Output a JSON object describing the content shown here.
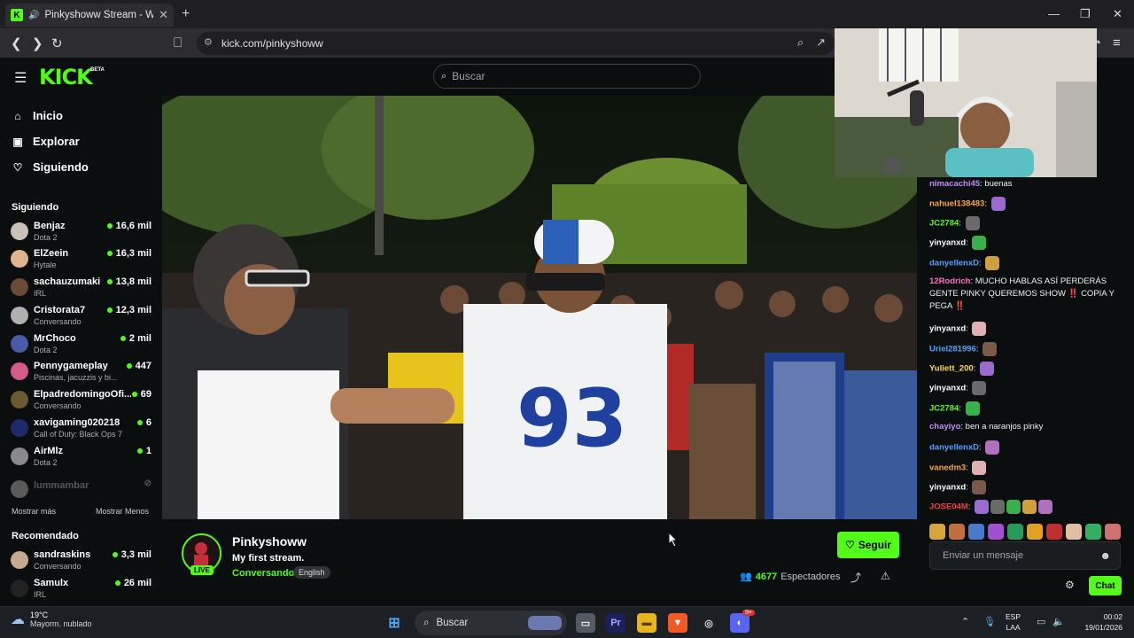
{
  "browser": {
    "tab_title": "Pinkyshoww Stream - Watch Live",
    "url": "kick.com/pinkyshoww"
  },
  "kick": {
    "logo": "KICK",
    "logo_badge": "BETA",
    "search_placeholder": "Buscar"
  },
  "sidebar": {
    "nav": [
      {
        "label": "Inicio",
        "icon": "home-icon"
      },
      {
        "label": "Explorar",
        "icon": "browse-icon"
      },
      {
        "label": "Siguiendo",
        "icon": "heart-icon"
      }
    ],
    "following_title": "Siguiendo",
    "following": [
      {
        "name": "Benjaz",
        "category": "Dota 2",
        "viewers": "16,6 mil",
        "avatar_color": "#c9c2b8"
      },
      {
        "name": "ElZeein",
        "category": "Hytale",
        "viewers": "16,3 mil",
        "avatar_color": "#e0b48c"
      },
      {
        "name": "sachauzumaki",
        "category": "IRL",
        "viewers": "13,8 mil",
        "avatar_color": "#6b4a3a"
      },
      {
        "name": "Cristorata7",
        "category": "Conversando",
        "viewers": "12,3 mil",
        "avatar_color": "#b0b0b0"
      },
      {
        "name": "MrChoco",
        "category": "Dota 2",
        "viewers": "2 mil",
        "avatar_color": "#4a5aa8"
      },
      {
        "name": "Pennygameplay",
        "category": "Piscinas, jacuzzis y bi...",
        "viewers": "447",
        "avatar_color": "#d45a8a"
      },
      {
        "name": "ElpadredomingoOfi...",
        "category": "Conversando",
        "viewers": "69",
        "avatar_color": "#6a5a30"
      },
      {
        "name": "xavigaming020218",
        "category": "Call of Duty: Black Ops 7",
        "viewers": "6",
        "avatar_color": "#1e2a6a"
      },
      {
        "name": "AirMlz",
        "category": "Dota 2",
        "viewers": "1",
        "avatar_color": "#8a8a8a"
      },
      {
        "name": "lummambar",
        "category": "",
        "viewers": "",
        "avatar_color": "#5a5a5a"
      }
    ],
    "show_more": "Mostrar más",
    "show_less": "Mostrar Menos",
    "recommended_title": "Recomendado",
    "recommended": [
      {
        "name": "sandraskins",
        "category": "Conversando",
        "viewers": "3,3 mil",
        "avatar_color": "#c8a890"
      },
      {
        "name": "Samulx",
        "category": "IRL",
        "viewers": "26 mil",
        "avatar_color": "#222222"
      }
    ]
  },
  "stream": {
    "streamer": "Pinkyshoww",
    "title": "My first stream.",
    "category": "Conversando",
    "language": "English",
    "live_badge": "LIVE",
    "follow_label": "Seguir",
    "viewer_count": "4677",
    "viewer_label": "Espectadores"
  },
  "chat": {
    "messages": [
      {
        "user": "nimacachi45",
        "color": "#c58af9",
        "text": "buenas",
        "emotes": 0
      },
      {
        "user": "nahuel138483",
        "color": "#f7a641",
        "text": "",
        "emotes": 1
      },
      {
        "user": "JC2784",
        "color": "#53fc18",
        "text": "",
        "emotes": 1
      },
      {
        "user": "yinyanxd",
        "color": "#ffffff",
        "text": "",
        "emotes": 1
      },
      {
        "user": "danyellenxD",
        "color": "#4da3ff",
        "text": "",
        "emotes": 1
      },
      {
        "user": "12Rodrich",
        "color": "#ff6ec7",
        "text": "MUCHO HABLAS ASÍ PERDERÁS GENTE PINKY QUEREMOS SHOW ‼️ COPIA Y PEGA ‼️",
        "emotes": 0
      },
      {
        "user": "yinyanxd",
        "color": "#ffffff",
        "text": "",
        "emotes": 1
      },
      {
        "user": "Uriel281996",
        "color": "#4da3ff",
        "text": "",
        "emotes": 1
      },
      {
        "user": "Yuliett_200",
        "color": "#ffd84d",
        "text": "",
        "emotes": 1
      },
      {
        "user": "yinyanxd",
        "color": "#ffffff",
        "text": "",
        "emotes": 1
      },
      {
        "user": "JC2784",
        "color": "#53fc18",
        "text": "",
        "emotes": 1
      },
      {
        "user": "chayiyo",
        "color": "#c58af9",
        "text": "ben a naranjos pinky",
        "emotes": 0
      },
      {
        "user": "danyellenxD",
        "color": "#4da3ff",
        "text": "",
        "emotes": 1
      },
      {
        "user": "vanedm3",
        "color": "#f7a641",
        "text": "",
        "emotes": 1
      },
      {
        "user": "yinyanxd",
        "color": "#ffffff",
        "text": "",
        "emotes": 1
      },
      {
        "user": "JOSE04M",
        "color": "#ff3b3b",
        "text": "",
        "emotes": 5
      }
    ],
    "input_placeholder": "Enviar un mensaje",
    "send_label": "Chat"
  },
  "taskbar": {
    "temperature": "19°C",
    "weather": "Mayorm. nublado",
    "search_label": "Buscar",
    "lang_top": "ESP",
    "lang_bottom": "LAA",
    "time": "00:02",
    "date": "19/01/2026",
    "discord_badge": "9+"
  }
}
